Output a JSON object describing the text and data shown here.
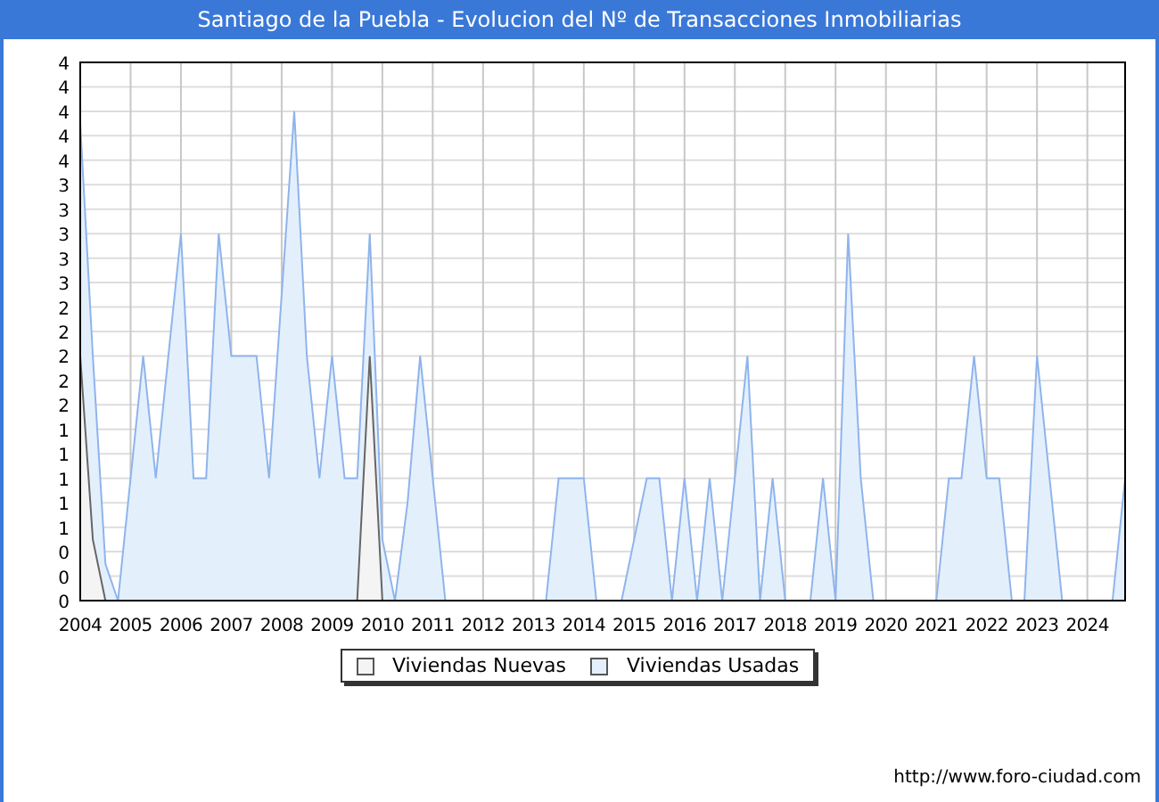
{
  "window": {
    "title": "Santiago de la Puebla - Evolucion del Nº de Transacciones Inmobiliarias"
  },
  "chart": {
    "chart_data": {
      "type": "area",
      "x": [
        2004,
        2004.25,
        2004.5,
        2004.75,
        2005,
        2005.25,
        2005.5,
        2005.75,
        2006,
        2006.25,
        2006.5,
        2006.75,
        2007,
        2007.25,
        2007.5,
        2007.75,
        2008,
        2008.25,
        2008.5,
        2008.75,
        2009,
        2009.25,
        2009.5,
        2009.75,
        2010,
        2010.25,
        2010.5,
        2010.75,
        2011,
        2011.25,
        2013.25,
        2013.5,
        2013.75,
        2014,
        2014.25,
        2014.75,
        2015,
        2015.25,
        2015.5,
        2015.75,
        2016,
        2016.25,
        2016.5,
        2016.75,
        2017,
        2017.25,
        2017.5,
        2017.75,
        2018,
        2018.5,
        2018.75,
        2019,
        2019.25,
        2019.5,
        2019.75,
        2021,
        2021.25,
        2021.5,
        2021.75,
        2022,
        2022.25,
        2022.5,
        2022.75,
        2023,
        2023.25,
        2023.5,
        2024.5,
        2024.75
      ],
      "series": [
        {
          "name": "Viviendas Nuevas",
          "color": "#f4f4f4",
          "values": [
            2,
            0.5,
            0,
            null,
            null,
            null,
            null,
            null,
            null,
            null,
            null,
            null,
            null,
            null,
            null,
            null,
            null,
            null,
            null,
            null,
            null,
            null,
            0,
            2,
            0,
            null,
            null,
            null,
            null,
            null,
            null,
            null,
            null,
            null,
            null,
            null,
            null,
            null,
            null,
            null,
            null,
            null,
            null,
            null,
            null,
            null,
            null,
            null,
            null,
            null,
            null,
            null,
            null,
            null,
            null,
            null,
            null,
            null,
            null,
            null,
            null,
            null,
            null,
            null,
            null,
            null,
            null,
            null
          ]
        },
        {
          "name": "Viviendas Usadas",
          "color": "#e3f0fc",
          "values": [
            3.9,
            2,
            0.3,
            0,
            1,
            2,
            1,
            2,
            3,
            1,
            1,
            3,
            2,
            2,
            2,
            1,
            2.5,
            4,
            2,
            1,
            2,
            1,
            1,
            3,
            0.5,
            0,
            0.8,
            2,
            1,
            0,
            0,
            1,
            1,
            1,
            0,
            0,
            0.5,
            1,
            1,
            0,
            1,
            0,
            1,
            0,
            1,
            2,
            0,
            1,
            0,
            0,
            1,
            0,
            3,
            1,
            0,
            0,
            1,
            1,
            2,
            1,
            1,
            0,
            0,
            2,
            1,
            0,
            0,
            1
          ]
        }
      ],
      "grid": true,
      "xlim": [
        2004,
        2024.75
      ],
      "ylim": [
        0,
        4.4
      ],
      "xticks": [
        2004,
        2005,
        2006,
        2007,
        2008,
        2009,
        2010,
        2011,
        2012,
        2013,
        2014,
        2015,
        2016,
        2017,
        2018,
        2019,
        2020,
        2021,
        2022,
        2023,
        2024
      ],
      "yticks": [
        {
          "value": 0,
          "label": "0"
        },
        {
          "value": 0.2,
          "label": "0"
        },
        {
          "value": 0.4,
          "label": "0"
        },
        {
          "value": 0.6,
          "label": "1"
        },
        {
          "value": 0.8,
          "label": "1"
        },
        {
          "value": 1,
          "label": "1"
        },
        {
          "value": 1.2,
          "label": "1"
        },
        {
          "value": 1.4,
          "label": "1"
        },
        {
          "value": 1.6,
          "label": "2"
        },
        {
          "value": 1.8,
          "label": "2"
        },
        {
          "value": 2,
          "label": "2"
        },
        {
          "value": 2.2,
          "label": "2"
        },
        {
          "value": 2.4,
          "label": "2"
        },
        {
          "value": 2.6,
          "label": "3"
        },
        {
          "value": 2.8,
          "label": "3"
        },
        {
          "value": 3,
          "label": "3"
        },
        {
          "value": 3.2,
          "label": "3"
        },
        {
          "value": 3.4,
          "label": "3"
        },
        {
          "value": 3.6,
          "label": "4"
        },
        {
          "value": 3.8,
          "label": "4"
        },
        {
          "value": 4,
          "label": "4"
        },
        {
          "value": 4.2,
          "label": "4"
        },
        {
          "value": 4.4,
          "label": "4"
        }
      ]
    }
  },
  "footer": {
    "url": "http://www.foro-ciudad.com"
  }
}
